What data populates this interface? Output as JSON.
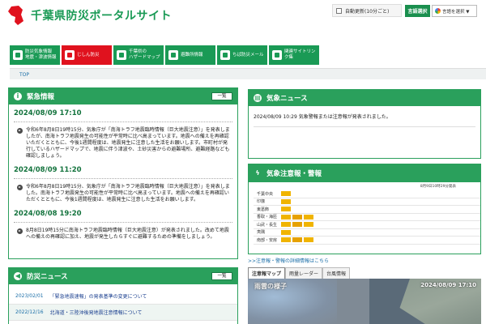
{
  "header": {
    "title": "千葉県防災ポータルサイト",
    "auto_update": "自動更新(10分ごと)",
    "language_button": "言語選択",
    "translate_label": "言語を選択 ▼"
  },
  "nav": [
    {
      "label": "防災気象情報\n地震・津波情報",
      "style": "green"
    },
    {
      "label": "じしん防災",
      "style": "red"
    },
    {
      "label": "千葉県の\nハザードマップ",
      "style": "green"
    },
    {
      "label": "避難所情報",
      "style": "green"
    },
    {
      "label": "ちば防災メール",
      "style": "green"
    },
    {
      "label": "関連サイトリンク集",
      "style": "green"
    }
  ],
  "breadcrumb": {
    "top": "TOP"
  },
  "emergency": {
    "title": "緊急情報",
    "list_button": "一覧",
    "items": [
      {
        "date": "2024/08/09 17:10",
        "text": "令和6年8月8日19時15分、気象庁が「南海トラフ地震臨時情報（巨大地震注意）」を発表しましたが、南海トラフ地震発生の可能性が平常時に比べ高まっています。地震への備えを再確認いただくとともに、今後1週間程度は、地震発生に注意した生活をお願いします。市町村が発行しているハザードマップで、地震に伴う津波や、土砂災害からの避難場所、避難経路なども確認しましょう。"
      },
      {
        "date": "2024/08/09 11:20",
        "text": "令和6年8月8日19時15分、気象庁が「南海トラフ地震臨時情報（巨大地震注意）」を発表しました。南海トラフ地震発生の可能性が平常時に比べ高まっています。地震への備えを再確認いただくとともに、今後1週間程度は、地震発生に注意した生活をお願いします。"
      },
      {
        "date": "2024/08/08 19:20",
        "text": "8月8日19時15分に南海トラフ地震臨時情報（巨大地震注意）が発表されました。改めて地震への備えの再確認に加え、地震が発生したらすぐに避難するための準備をしましょう。"
      }
    ]
  },
  "disaster_news": {
    "title": "防災ニュース",
    "list_button": "一覧",
    "items": [
      {
        "date": "2023/02/01",
        "title": "「緊急地震速報」の発表基準の変更について"
      },
      {
        "date": "2022/12/16",
        "title": "北海道・三陸沖後発地震注意情報について"
      }
    ]
  },
  "weather_news": {
    "title": "気象ニュース",
    "text": "2024/08/09 10:29 気象警報または注意報が発表されました。"
  },
  "warnings": {
    "title": "気象注意報・警報",
    "issued": "8月9日10時29分発表",
    "rows": [
      {
        "name": "千葉中央",
        "badges": 1
      },
      {
        "name": "印旛",
        "badges": 1
      },
      {
        "name": "東葛飾",
        "badges": 1
      },
      {
        "name": "香取・海匝",
        "badges": 3
      },
      {
        "name": "山武・長生",
        "badges": 3
      },
      {
        "name": "夷隅",
        "badges": 1
      },
      {
        "name": "南部・安房",
        "badges": 3
      }
    ],
    "link": ">>注意報・警報の詳細情報はこちら"
  },
  "map_tabs": {
    "items": [
      "注意報マップ",
      "雨量レーダー",
      "台風情報"
    ],
    "active": 0
  },
  "radar": {
    "label": "雨雲の様子",
    "timestamp": "2024/08/09 17:10"
  },
  "colors": {
    "brand_green": "#2aa05c",
    "alert_red": "#e0121e",
    "warning_yellow": "#f0b400"
  }
}
